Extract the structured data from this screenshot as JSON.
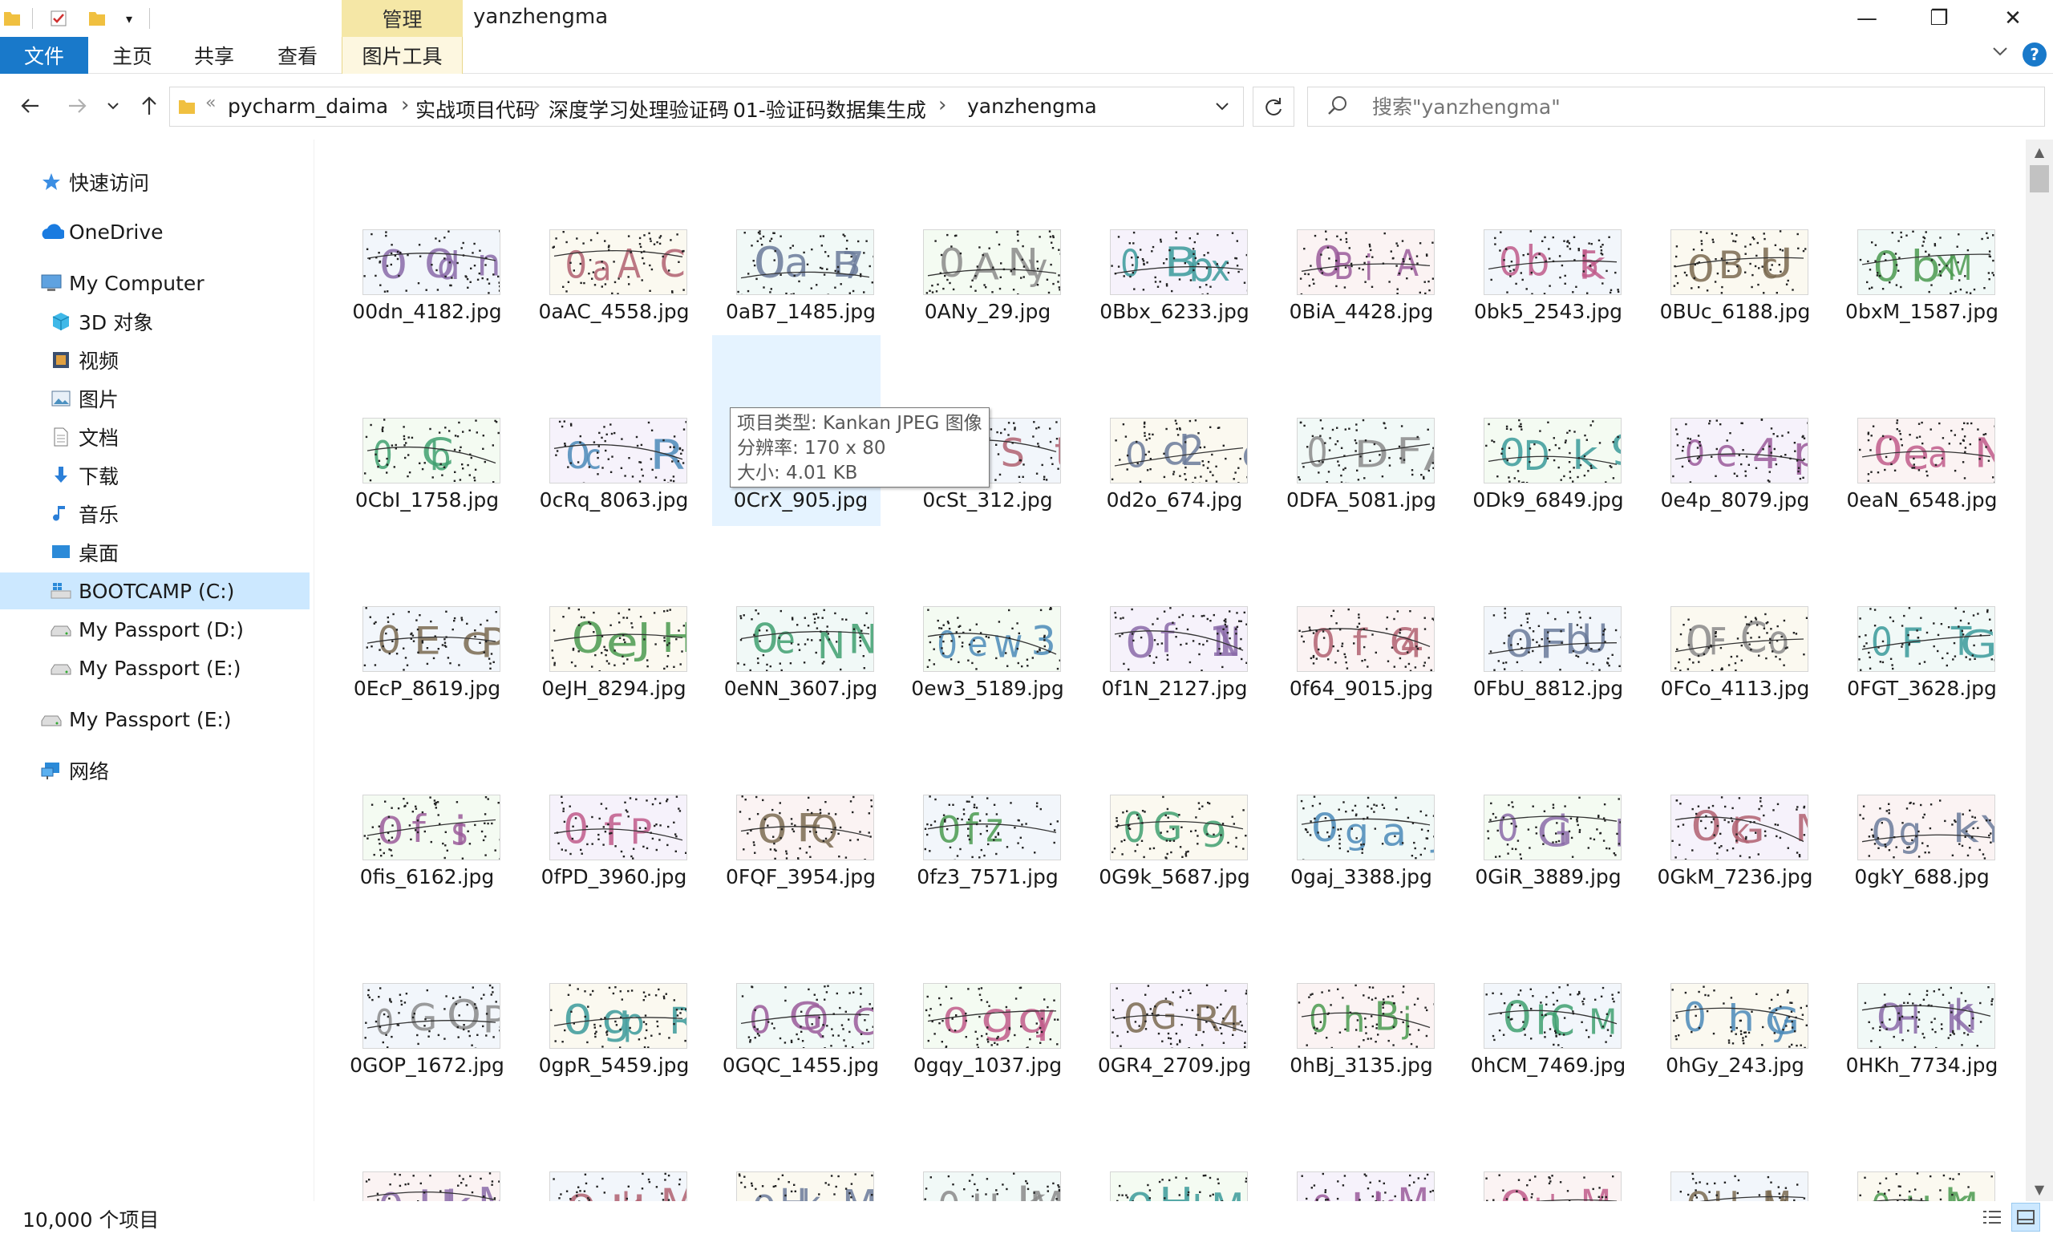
{
  "window": {
    "title": "yanzhengma",
    "context_tab_group": "管理",
    "minimize": "—",
    "maximize": "❐",
    "close": "✕"
  },
  "ribbon": {
    "tabs": [
      "文件",
      "主页",
      "共享",
      "查看",
      "图片工具"
    ],
    "help": "?"
  },
  "address": {
    "overflow": "«",
    "breadcrumbs": [
      "pycharm_daima",
      "实战项目代码",
      "深度学习处理验证码",
      "01-验证码数据集生成",
      "yanzhengma"
    ],
    "separator": "›"
  },
  "search": {
    "placeholder": "搜索\"yanzhengma\""
  },
  "nav": {
    "items": [
      {
        "label": "快速访问",
        "icon": "star-icon"
      },
      {
        "label": "OneDrive",
        "icon": "cloud-icon"
      },
      {
        "label": "My Computer",
        "icon": "computer-icon"
      },
      {
        "label": "3D 对象",
        "icon": "cube-icon"
      },
      {
        "label": "视频",
        "icon": "video-icon"
      },
      {
        "label": "图片",
        "icon": "picture-icon"
      },
      {
        "label": "文档",
        "icon": "document-icon"
      },
      {
        "label": "下载",
        "icon": "download-icon"
      },
      {
        "label": "音乐",
        "icon": "music-icon"
      },
      {
        "label": "桌面",
        "icon": "desktop-icon"
      },
      {
        "label": "BOOTCAMP (C:)",
        "icon": "windows-drive-icon"
      },
      {
        "label": "My Passport (D:)",
        "icon": "drive-icon"
      },
      {
        "label": "My Passport (E:)",
        "icon": "drive-icon"
      },
      {
        "label": "My Passport (E:)",
        "icon": "drive-icon"
      },
      {
        "label": "网络",
        "icon": "network-icon"
      }
    ]
  },
  "files": [
    "00dn_4182.jpg",
    "0aAC_4558.jpg",
    "0aB7_1485.jpg",
    "0ANy_29.jpg",
    "0Bbx_6233.jpg",
    "0BiA_4428.jpg",
    "0bk5_2543.jpg",
    "0BUc_6188.jpg",
    "0bxM_1587.jpg",
    "0CbI_1758.jpg",
    "0cRq_8063.jpg",
    "0CrX_905.jpg",
    "0cSt_312.jpg",
    "0d2o_674.jpg",
    "0DFA_5081.jpg",
    "0Dk9_6849.jpg",
    "0e4p_8079.jpg",
    "0eaN_6548.jpg",
    "0EcP_8619.jpg",
    "0eJH_8294.jpg",
    "0eNN_3607.jpg",
    "0ew3_5189.jpg",
    "0f1N_2127.jpg",
    "0f64_9015.jpg",
    "0FbU_8812.jpg",
    "0FCo_4113.jpg",
    "0FGT_3628.jpg",
    "0fis_6162.jpg",
    "0fPD_3960.jpg",
    "0FQF_3954.jpg",
    "0fz3_7571.jpg",
    "0G9k_5687.jpg",
    "0gaj_3388.jpg",
    "0GiR_3889.jpg",
    "0GkM_7236.jpg",
    "0gkY_688.jpg",
    "0GOP_1672.jpg",
    "0gpR_5459.jpg",
    "0GQC_1455.jpg",
    "0gqy_1037.jpg",
    "0GR4_2709.jpg",
    "0hBj_3135.jpg",
    "0hCM_7469.jpg",
    "0hGy_243.jpg",
    "0HKh_7734.jpg"
  ],
  "partial_row_count": 9,
  "tooltip": {
    "line1": "项目类型: Kankan JPEG 图像",
    "line2": "分辨率: 170 x 80",
    "line3": "大小: 4.01 KB"
  },
  "status": {
    "item_count": "10,000 个项目"
  },
  "colors": {
    "file_tab": "#1979ca",
    "context_tab": "#f5e7a6",
    "selection": "#cce8ff",
    "hover": "#e5f3ff"
  }
}
